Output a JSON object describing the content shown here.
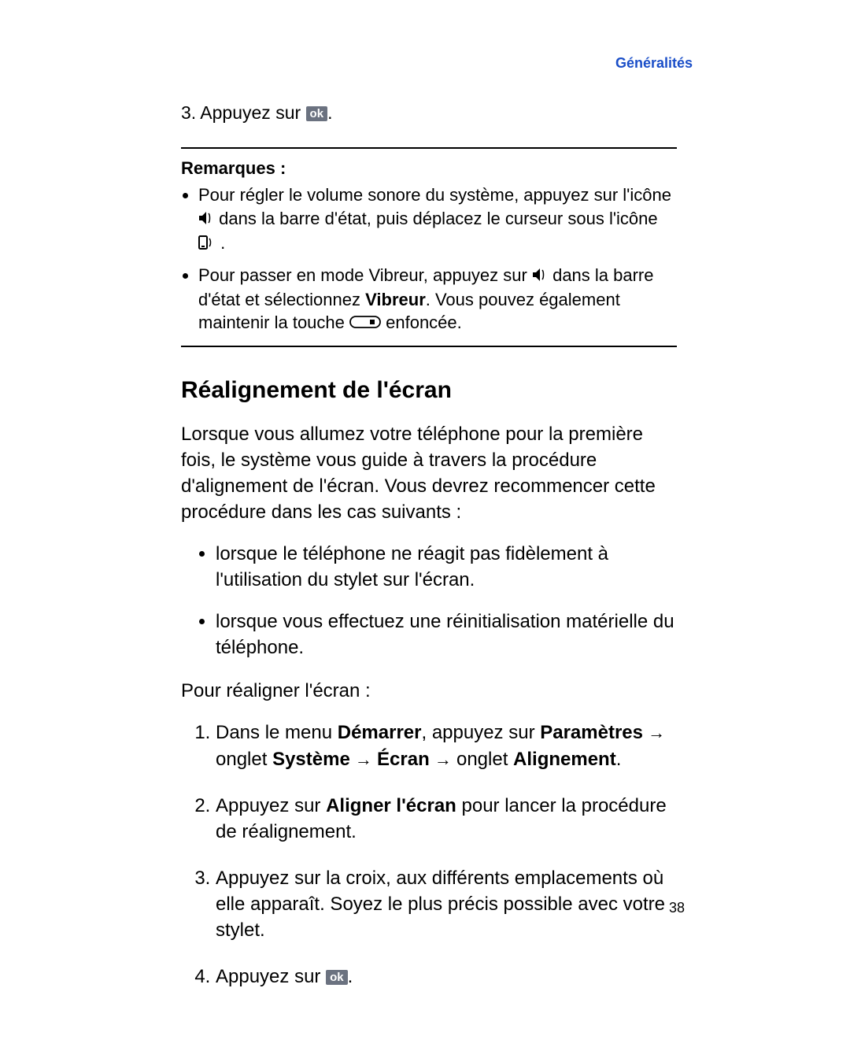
{
  "header": {
    "section": "Généralités"
  },
  "step3": {
    "prefix": "3. Appuyez sur ",
    "ok": "ok",
    "suffix": "."
  },
  "notes": {
    "title": "Remarques",
    "item1": {
      "a": "Pour régler le volume sonore du système, appuyez sur l'icône ",
      "b": " dans la barre d'état, puis déplacez le curseur sous l'icône ",
      "c": "."
    },
    "item2": {
      "a": "Pour passer en mode Vibreur, appuyez sur ",
      "b": " dans la barre d'état et sélectionnez ",
      "vib": "Vibreur",
      "c": ". Vous pouvez également maintenir la touche ",
      "d": " enfoncée."
    }
  },
  "section": {
    "title": "Réalignement de l'écran",
    "intro": "Lorsque vous allumez votre téléphone pour la première fois, le système vous guide à travers la procédure d'alignement de l'écran. Vous devrez recommencer cette procédure dans les cas suivants :",
    "case1": "lorsque le téléphone ne réagit pas fidèlement à l'utilisation du stylet sur l'écran.",
    "case2": "lorsque vous effectuez une réinitialisation matérielle du téléphone.",
    "lead": "Pour réaligner l'écran :",
    "step1": {
      "a": "Dans le menu ",
      "demarrer": "Démarrer",
      "b": ", appuyez sur ",
      "param": "Paramètres",
      "arrow": " → ",
      "c": "onglet ",
      "systeme": "Système",
      "ecran": "Écran",
      "align": "Alignement",
      "dot": "."
    },
    "step2": {
      "a": "Appuyez sur ",
      "aligner": "Aligner l'écran",
      "b": " pour lancer la procédure de réalignement."
    },
    "step3": "Appuyez sur la croix, aux différents emplacements où elle apparaît. Soyez le plus précis possible avec votre stylet.",
    "step4": {
      "a": "Appuyez sur ",
      "ok": "ok",
      "b": "."
    }
  },
  "page_number": "38"
}
